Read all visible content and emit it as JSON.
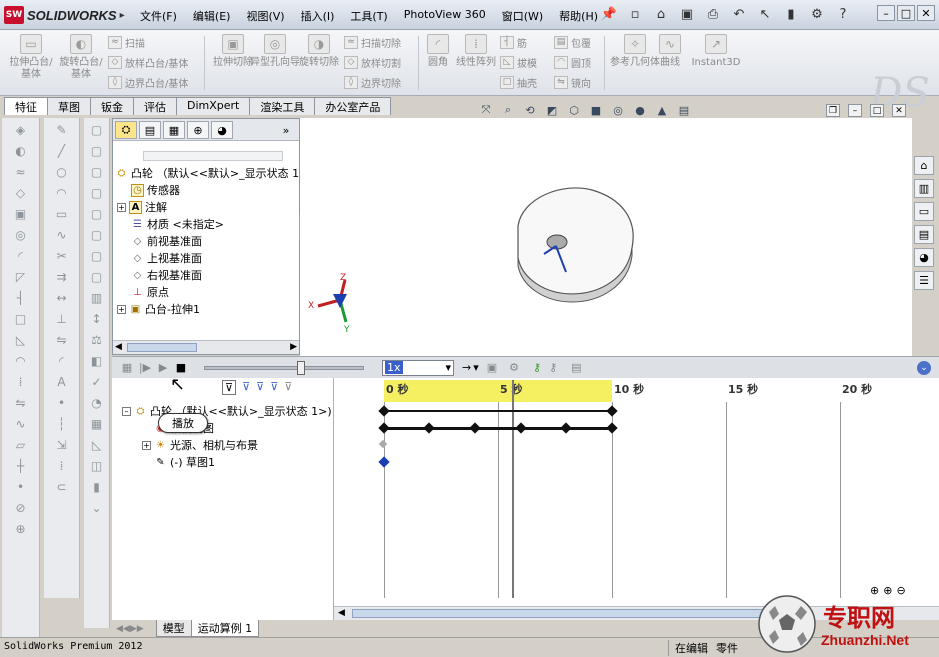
{
  "app": {
    "logo_badge": "SW",
    "logo_text": "SOLIDWORKS",
    "logo_arrow": "▸"
  },
  "menus": [
    "文件(F)",
    "编辑(E)",
    "视图(V)",
    "插入(I)",
    "工具(T)",
    "PhotoView 360",
    "窗口(W)",
    "帮助(H)"
  ],
  "commands": {
    "extrude_boss": "拉伸凸台/基体",
    "revolve_boss": "旋转凸台/基体",
    "sweep": "扫描",
    "loft_boss": "放样凸台/基体",
    "boundary_boss": "边界凸台/基体",
    "extrude_cut": "拉伸切除",
    "hole_wizard": "异型孔向导",
    "revolve_cut": "旋转切除",
    "sweep_cut": "扫描切除",
    "loft_cut": "放样切割",
    "boundary_cut": "边界切除",
    "fillet": "圆角",
    "linear_pattern": "线性阵列",
    "rib": "筋",
    "draft": "拔模",
    "shell": "抽壳",
    "wrap": "包覆",
    "dome": "圆顶",
    "mirror": "镜向",
    "ref_geometry": "参考几何体",
    "curves": "曲线",
    "instant3d": "Instant3D"
  },
  "tabs": [
    {
      "label": "特征",
      "active": true
    },
    {
      "label": "草图",
      "active": false
    },
    {
      "label": "钣金",
      "active": false
    },
    {
      "label": "评估",
      "active": false
    },
    {
      "label": "DimXpert",
      "active": false
    },
    {
      "label": "渲染工具",
      "active": false
    },
    {
      "label": "办公室产品",
      "active": false
    }
  ],
  "feature_tree": {
    "root": "凸轮 （默认<<默认>_显示状态 1",
    "items": [
      {
        "label": "传感器",
        "icon": "sensor-icon",
        "expand": false
      },
      {
        "label": "注解",
        "icon": "annotation-icon",
        "expand": true
      },
      {
        "label": "材质 <未指定>",
        "icon": "material-icon",
        "expand": false
      },
      {
        "label": "前视基准面",
        "icon": "plane-icon",
        "expand": false
      },
      {
        "label": "上视基准面",
        "icon": "plane-icon",
        "expand": false
      },
      {
        "label": "右视基准面",
        "icon": "plane-icon",
        "expand": false
      },
      {
        "label": "原点",
        "icon": "origin-icon",
        "expand": false
      },
      {
        "label": "凸台-拉伸1",
        "icon": "extrude-icon",
        "expand": true
      }
    ]
  },
  "motion": {
    "speed": "1x",
    "tooltip": "播放",
    "root": "凸轮 （默认<<默认>_显示状态 1>)",
    "items": [
      "相机视图",
      "光源、相机与布景",
      "(-) 草图1"
    ],
    "ticks": [
      "0 秒",
      "5 秒",
      "10 秒",
      "15 秒",
      "20 秒"
    ]
  },
  "bottom_tabs": [
    {
      "label": "模型",
      "active": false
    },
    {
      "label": "运动算例 1",
      "active": true
    }
  ],
  "status": {
    "product": "SolidWorks Premium 2012",
    "mode": "在编辑",
    "doc": "零件"
  },
  "watermark": {
    "site": "专职网",
    "domain": "Zhuanzhi.Net"
  },
  "colors": {
    "timeline_yellow": "#f5ef62",
    "key_blue": "#1b3fb0",
    "brand_red": "#c8102e"
  }
}
